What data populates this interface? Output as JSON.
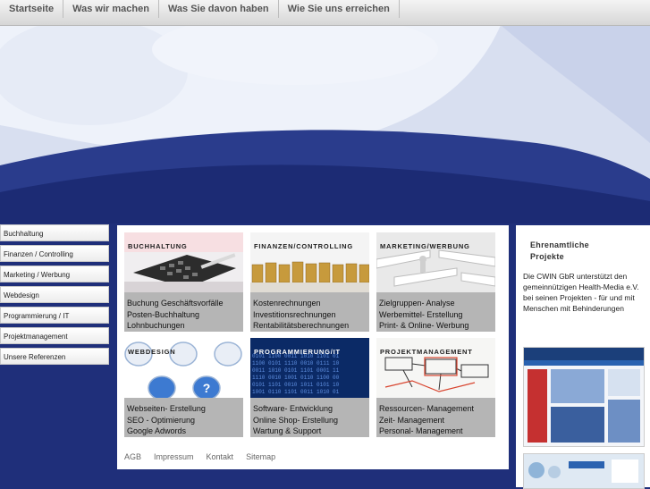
{
  "nav": {
    "items": [
      "Startseite",
      "Was wir machen",
      "Was Sie davon haben",
      "Wie Sie uns erreichen"
    ]
  },
  "sidebar": {
    "items": [
      "Buchhaltung",
      "Finanzen / Controlling",
      "Marketing / Werbung",
      "Webdesign",
      "Programmierung / IT",
      "Projektmanagement",
      "Unsere Referenzen"
    ]
  },
  "cards": [
    {
      "title": "BUCHHALTUNG",
      "lines": [
        "Buchung Geschäftsvorfälle",
        "Posten-Buchhaltung",
        "Lohnbuchungen"
      ]
    },
    {
      "title": "FINANZEN/CONTROLLING",
      "lines": [
        "Kostenrechnungen",
        "Investitionsrechnungen",
        "Rentabilitätsberechnungen"
      ]
    },
    {
      "title": "MARKETING/WERBUNG",
      "lines": [
        "Zielgruppen- Analyse",
        "Werbemittel- Erstellung",
        "Print- & Online- Werbung"
      ]
    },
    {
      "title": "WEBDESIGN",
      "lines": [
        "Webseiten- Erstellung",
        "SEO - Optimierung",
        "Google Adwords"
      ]
    },
    {
      "title": "PROGRAMMIERUNG/IT",
      "lines": [
        "Software- Entwicklung",
        "Online Shop- Erstellung",
        "Wartung & Support"
      ]
    },
    {
      "title": "PROJEKTMANAGEMENT",
      "lines": [
        "Ressourcen- Management",
        "Zeit- Management",
        "Personal- Management"
      ]
    }
  ],
  "footer": {
    "links": [
      "AGB",
      "Impressum",
      "Kontakt",
      "Sitemap"
    ]
  },
  "right_panel": {
    "heading_line1": "Ehrenamtliche",
    "heading_line2": "Projekte",
    "text": "Die CWIN GbR unterstützt den gemeinnützigen Health-Media e.V. bei seinen Projekten - für und mit Menschen mit Behinderungen"
  },
  "colors": {
    "background_blue": "#1f2f7a",
    "card_grey": "#b5b5b5",
    "nav_text": "#555555"
  }
}
